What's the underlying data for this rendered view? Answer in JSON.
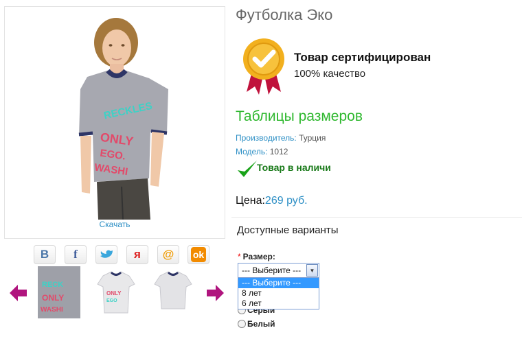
{
  "product": {
    "title": "Футболка Эко",
    "download_label": "Скачать"
  },
  "certificate": {
    "title": "Товар сертифицирован",
    "subtitle": "100% качество"
  },
  "size_table_link": "Таблицы размеров",
  "meta": {
    "manufacturer_label": "Производитель:",
    "manufacturer_value": "Турция",
    "model_label": "Модель:",
    "model_value": "1012"
  },
  "stock": "Товар в наличи",
  "price": {
    "label": "Цена:",
    "value": "269 руб."
  },
  "options": {
    "heading": "Доступные варианты",
    "size_required_mark": "*",
    "size_label": "Размер:",
    "size_selected": "--- Выберите ---",
    "size_options": [
      "--- Выберите ---",
      "8 лет",
      "6 лет"
    ],
    "color_options": [
      "Серый",
      "Белый"
    ]
  },
  "social": [
    "vk-icon",
    "facebook-icon",
    "twitter-icon",
    "moikrug-icon",
    "mailru-icon",
    "odnoklassniki-icon"
  ],
  "colors": {
    "accent_blue": "#2d8fc5",
    "green_link": "#2fb82f",
    "stock_green": "#1a7a1a",
    "badge_gold": "#f2b01e",
    "ribbon_red": "#c0123c",
    "arrow_magenta": "#b0157e"
  }
}
